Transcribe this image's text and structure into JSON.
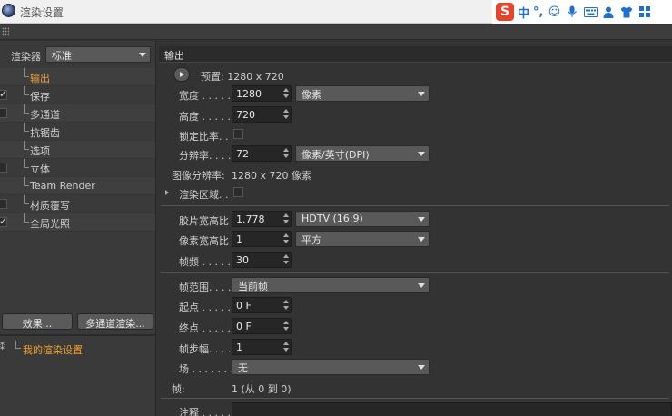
{
  "window": {
    "title": "渲染设置"
  },
  "ime": {
    "logo": "S",
    "lang": "中",
    "punct": "°,",
    "icons": [
      "smiley-icon",
      "microphone-icon",
      "keyboard-icon",
      "user-icon",
      "tshirt-icon",
      "grid-icon"
    ]
  },
  "left": {
    "renderer_label": "渲染器",
    "renderer_value": "标准",
    "items": [
      {
        "label": "输出",
        "checkbox": false,
        "checked": false,
        "active": true
      },
      {
        "label": "保存",
        "checkbox": true,
        "checked": true,
        "active": false
      },
      {
        "label": "多通道",
        "checkbox": true,
        "checked": false,
        "active": false
      },
      {
        "label": "抗锯齿",
        "checkbox": false,
        "checked": false,
        "active": false
      },
      {
        "label": "选项",
        "checkbox": false,
        "checked": false,
        "active": false
      },
      {
        "label": "立体",
        "checkbox": true,
        "checked": false,
        "active": false
      },
      {
        "label": "Team Render",
        "checkbox": false,
        "checked": false,
        "active": false
      },
      {
        "label": "材质覆写",
        "checkbox": true,
        "checked": false,
        "active": false
      },
      {
        "label": "全局光照",
        "checkbox": true,
        "checked": true,
        "active": false
      }
    ],
    "effects_button": "效果...",
    "multipass_button": "多通道渲染...",
    "preset_name": "我的渲染设置"
  },
  "output": {
    "header": "输出",
    "preset_label": "预置: 1280 x 720",
    "width_label": "宽度 . . . . .",
    "width_value": "1280",
    "unit_value": "像素",
    "height_label": "高度 . . . . .",
    "height_value": "720",
    "lock_label": "锁定比率. .",
    "lock_checked": false,
    "res_label": "分辨率. . . .",
    "res_value": "72",
    "res_unit": "像素/英寸(DPI)",
    "img_res_label": "图像分辨率:",
    "img_res_value": "1280 x 720 像素",
    "region_label": "渲染区域. .",
    "film_label": "胶片宽高比",
    "film_value": "1.778",
    "film_preset": "HDTV (16:9)",
    "pixel_label": "像素宽高比",
    "pixel_value": "1",
    "pixel_preset": "平方",
    "fps_label": "帧频 . . . . .",
    "fps_value": "30",
    "range_label": "帧范围. . . .",
    "range_value": "当前帧",
    "start_label": "起点 . . . . .",
    "start_value": "0 F",
    "end_label": "终点 . . . . .",
    "end_value": "0 F",
    "step_label": "帧步幅. . . .",
    "step_value": "1",
    "field_label": "场 . . . . . . .",
    "field_value": "无",
    "frames_label": "帧:",
    "frames_value": "1 (从 0 到 0)",
    "notes_label": "注释 . . . . ."
  }
}
